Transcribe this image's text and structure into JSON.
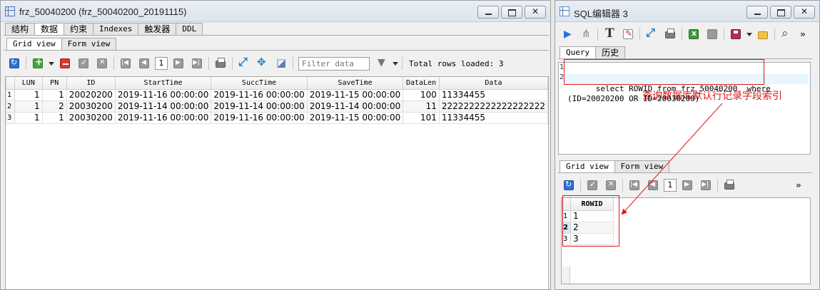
{
  "left": {
    "title": "frz_50040200 (frz_50040200_20191115)",
    "tabs": [
      "结构",
      "数据",
      "约束",
      "Indexes",
      "触发器",
      "DDL"
    ],
    "subtabs": [
      "Grid view",
      "Form view"
    ],
    "page_number": "1",
    "filter_placeholder": "Filter data",
    "total_rows": "Total rows loaded: 3",
    "columns": [
      "LUN",
      "PN",
      "ID",
      "StartTime",
      "SuccTime",
      "SaveTime",
      "DataLen",
      "Data"
    ],
    "rows": [
      {
        "n": "1",
        "cells": [
          "1",
          "1",
          "20020200",
          "2019-11-16 00:00:00",
          "2019-11-16 00:00:00",
          "2019-11-15 00:00:00",
          "100",
          "11334455"
        ]
      },
      {
        "n": "2",
        "cells": [
          "1",
          "2",
          "20030200",
          "2019-11-14 00:00:00",
          "2019-11-14 00:00:00",
          "2019-11-14 00:00:00",
          "11",
          "2222222222222222222"
        ]
      },
      {
        "n": "3",
        "cells": [
          "1",
          "1",
          "20030200",
          "2019-11-16 00:00:00",
          "2019-11-16 00:00:00",
          "2019-11-15 00:00:00",
          "101",
          "11334455"
        ]
      }
    ]
  },
  "right": {
    "title": "SQL编辑器 3",
    "tabs": [
      "Query",
      "历史"
    ],
    "gutter": [
      "1",
      "2"
    ],
    "sql_line1": "select ROWID from frz_50040200  where",
    "sql_line2": "(ID=20020200 OR ID=20030200)",
    "subtabs": [
      "Grid view",
      "Form view"
    ],
    "page_number": "1",
    "more": "»",
    "result_column": "ROWID",
    "result_rows": [
      {
        "n": "1",
        "value": "1"
      },
      {
        "n": "2",
        "value": "2"
      },
      {
        "n": "3",
        "value": "3"
      }
    ]
  },
  "annotation": {
    "text": "查询数据库默认行记录字段索引",
    "color": "#e01818"
  }
}
